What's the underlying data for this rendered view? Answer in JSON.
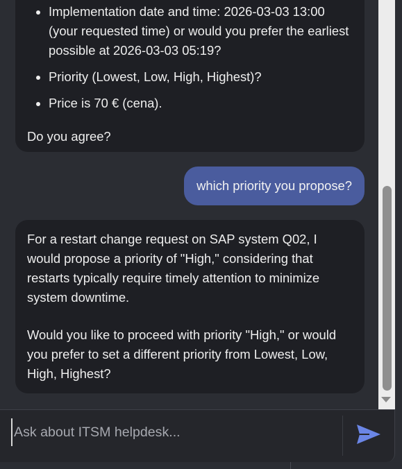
{
  "messages": {
    "prev_bot": {
      "bullets": [
        "Implementation date and time: 2026-03-03 13:00 (your requested time) or would you prefer the earliest possible at 2026-03-03 05:19?",
        "Priority (Lowest, Low, High, Highest)?",
        "Price is 70 € (cena)."
      ],
      "closing": "Do you agree?"
    },
    "user": {
      "text": "which priority you propose?"
    },
    "bot": {
      "paragraph1": "For a restart change request on SAP system Q02, I would propose a priority of \"High,\" considering that restarts typically require timely attention to minimize system downtime.",
      "paragraph2": "Would you like to proceed with priority \"High,\" or would you prefer to set a different priority from Lowest, Low, High, Highest?"
    }
  },
  "input": {
    "placeholder": "Ask about ITSM helpdesk...",
    "value": ""
  },
  "icons": {
    "send": "send-icon",
    "scroll_down": "chevron-down-icon"
  },
  "colors": {
    "user_bubble": "#4a5c9e",
    "bot_bubble": "#1e1f24",
    "send_accent": "#6b86e6"
  }
}
